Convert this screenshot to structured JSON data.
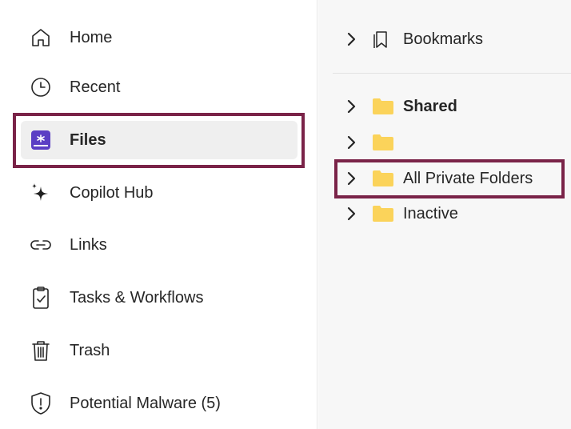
{
  "sidebar": {
    "items": [
      {
        "label": "Home",
        "icon": "home-icon"
      },
      {
        "label": "Recent",
        "icon": "clock-icon"
      },
      {
        "label": "Files",
        "icon": "files-icon",
        "active": true
      },
      {
        "label": "Copilot Hub",
        "icon": "sparkle-icon"
      },
      {
        "label": "Links",
        "icon": "link-icon"
      },
      {
        "label": "Tasks & Workflows",
        "icon": "clipboard-check-icon"
      },
      {
        "label": "Trash",
        "icon": "trash-icon"
      },
      {
        "label": "Potential Malware (5)",
        "icon": "shield-alert-icon"
      }
    ]
  },
  "tree": {
    "bookmarks": {
      "label": "Bookmarks",
      "icon": "bookmark-icon"
    },
    "folders": [
      {
        "label": "Shared",
        "bold": true,
        "icon": "folder-icon"
      },
      {
        "label": "",
        "bold": false,
        "icon": "folder-icon"
      },
      {
        "label": "All Private Folders",
        "bold": false,
        "icon": "folder-icon"
      },
      {
        "label": "Inactive",
        "bold": false,
        "icon": "folder-icon"
      }
    ]
  },
  "colors": {
    "highlight": "#7a2348",
    "files_icon": "#5b3fc4",
    "folder": "#fbd35a",
    "active_bg": "#efefef",
    "panel_bg": "#f7f7f7"
  }
}
